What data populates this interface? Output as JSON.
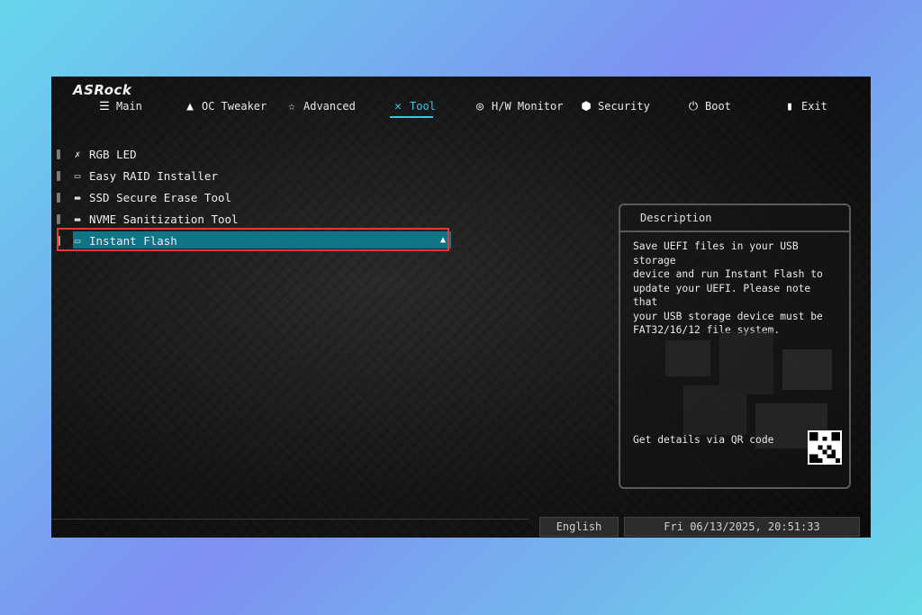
{
  "brand": "ASRock",
  "nav": [
    {
      "label": "Main",
      "icon": "main-list-icon"
    },
    {
      "label": "OC Tweaker",
      "icon": "rocket-icon"
    },
    {
      "label": "Advanced",
      "icon": "star-icon"
    },
    {
      "label": "Tool",
      "icon": "tool-icon",
      "active": true
    },
    {
      "label": "H/W Monitor",
      "icon": "monitor-icon"
    },
    {
      "label": "Security",
      "icon": "shield-icon"
    },
    {
      "label": "Boot",
      "icon": "power-icon"
    },
    {
      "label": "Exit",
      "icon": "exit-door-icon"
    }
  ],
  "menu": [
    {
      "label": "RGB LED",
      "icon": "rgb-tool-icon"
    },
    {
      "label": "Easy RAID Installer",
      "icon": "raid-icon"
    },
    {
      "label": "SSD Secure Erase Tool",
      "icon": "folder-icon"
    },
    {
      "label": "NVME Sanitization Tool",
      "icon": "folder-icon"
    },
    {
      "label": "Instant Flash",
      "icon": "bios-chip-icon",
      "selected": true
    }
  ],
  "description": {
    "title": "Description",
    "lines": [
      "Save UEFI files in your USB storage",
      "device and run Instant Flash to",
      "update your UEFI. Please note that",
      "your USB storage device must be",
      "FAT32/16/12 file system."
    ],
    "qr_label": "Get details via QR code"
  },
  "footer": {
    "language": "English",
    "datetime": "Fri 06/13/2025, 20:51:33"
  },
  "colors": {
    "accent": "#3ec6e8",
    "selection": "#0f7485",
    "highlight_border": "#e53935"
  }
}
